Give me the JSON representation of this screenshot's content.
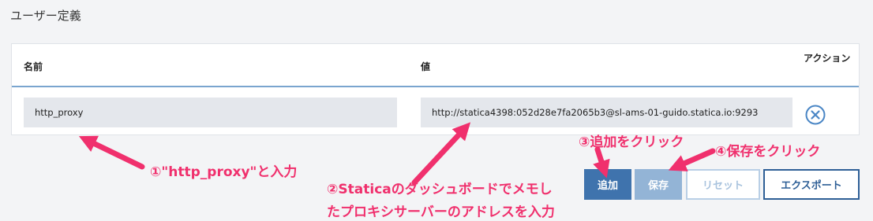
{
  "section": {
    "title": "ユーザー定義"
  },
  "table": {
    "headers": {
      "name": "名前",
      "value": "値",
      "action": "アクション"
    },
    "rows": [
      {
        "name": "http_proxy",
        "value": "http://statica4398:052d28e7fa2065b3@sl-ams-01-guido.statica.io:9293",
        "remove_icon": "circle-x-icon"
      }
    ]
  },
  "buttons": {
    "add": "追加",
    "save": "保存",
    "reset": "リセット",
    "export": "エクスポート"
  },
  "annotations": {
    "step1": "①\"http_proxy\"と入力",
    "step2_line1": "②Staticaのダッシュボードでメモし",
    "step2_line2": "たプロキシサーバーのアドレスを入力",
    "step3": "③追加をクリック",
    "step4": "④保存をクリック"
  },
  "colors": {
    "annotation": "#f0306d",
    "primary": "#3f73ad",
    "primary_disabled": "#93b4d6",
    "header_rule": "#7aa5cf",
    "remove_icon": "#4a86c5"
  }
}
